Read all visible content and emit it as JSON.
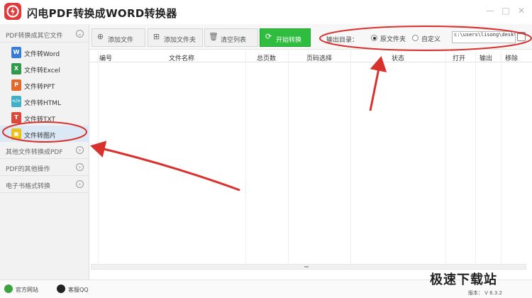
{
  "app": {
    "title": "闪电PDF转换成WORD转换器"
  },
  "window_controls": {
    "minimize": "—",
    "maximize": "□",
    "close": "✕"
  },
  "sidebar": {
    "categories": [
      {
        "label": "PDF转换成其它文件",
        "chevron": "⌄"
      },
      {
        "label": "其他文件转换成PDF",
        "chevron": "›"
      },
      {
        "label": "PDF的其他操作",
        "chevron": "›"
      },
      {
        "label": "电子书格式转换",
        "chevron": "›"
      }
    ],
    "items": [
      {
        "label": "文件转Word",
        "icon": "W",
        "color": "#3a7bd5"
      },
      {
        "label": "文件转Excel",
        "icon": "X",
        "color": "#2f9a4a"
      },
      {
        "label": "文件转PPT",
        "icon": "P",
        "color": "#e06a2b"
      },
      {
        "label": "文件转HTML",
        "icon": "</>",
        "color": "#3fb0c6"
      },
      {
        "label": "文件转TXT",
        "icon": "T",
        "color": "#d94a3d"
      },
      {
        "label": "文件转图片",
        "icon": "▣",
        "color": "#e8c21a",
        "active": true
      }
    ]
  },
  "toolbar": {
    "add_file": "添加文件",
    "add_folder": "添加文件夹",
    "clear_list": "清空列表",
    "start": "开始转换"
  },
  "output": {
    "label": "输出目录：",
    "option_original": "原文件夹",
    "option_custom": "自定义",
    "selected": "原文件夹",
    "path": "c:\\users\\lisong\\deskto"
  },
  "table": {
    "columns": [
      "编号",
      "文件名称",
      "总页数",
      "页码选择",
      "状态",
      "打开",
      "输出",
      "移除"
    ],
    "rows": []
  },
  "statusbar": {
    "website": "官方网站",
    "qq": "客服QQ",
    "version": "版本： V 6.3.2"
  },
  "watermark": "极速下载站",
  "colors": {
    "accent_green": "#2ebd3e",
    "annotation_red": "#d9312e",
    "logo_red": "#e03a3a"
  }
}
